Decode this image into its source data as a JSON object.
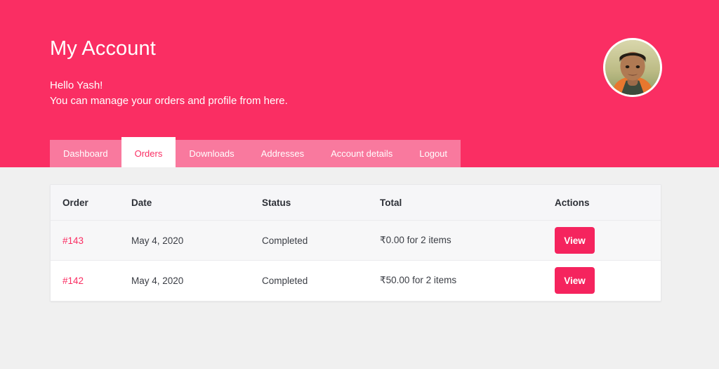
{
  "hero": {
    "title": "My Account",
    "greeting": "Hello Yash!",
    "subtitle": "You can manage your orders and profile from here.",
    "background_color": "#fa2e63",
    "avatar_name": "user-avatar-photo"
  },
  "tabs": [
    {
      "label": "Dashboard",
      "active": false
    },
    {
      "label": "Orders",
      "active": true
    },
    {
      "label": "Downloads",
      "active": false
    },
    {
      "label": "Addresses",
      "active": false
    },
    {
      "label": "Account details",
      "active": false
    },
    {
      "label": "Logout",
      "active": false
    }
  ],
  "orders_table": {
    "columns": [
      "Order",
      "Date",
      "Status",
      "Total",
      "Actions"
    ],
    "rows": [
      {
        "order": "#143",
        "date": "May 4, 2020",
        "status": "Completed",
        "total": "₹0.00 for 2 items",
        "action_label": "View"
      },
      {
        "order": "#142",
        "date": "May 4, 2020",
        "status": "Completed",
        "total": "₹50.00 for 2 items",
        "action_label": "View"
      }
    ]
  },
  "colors": {
    "brand_pink": "#fa2e63",
    "tab_inactive_pink": "#f9799e",
    "button_pink": "#f5245e",
    "page_background": "#f0f0f0"
  }
}
